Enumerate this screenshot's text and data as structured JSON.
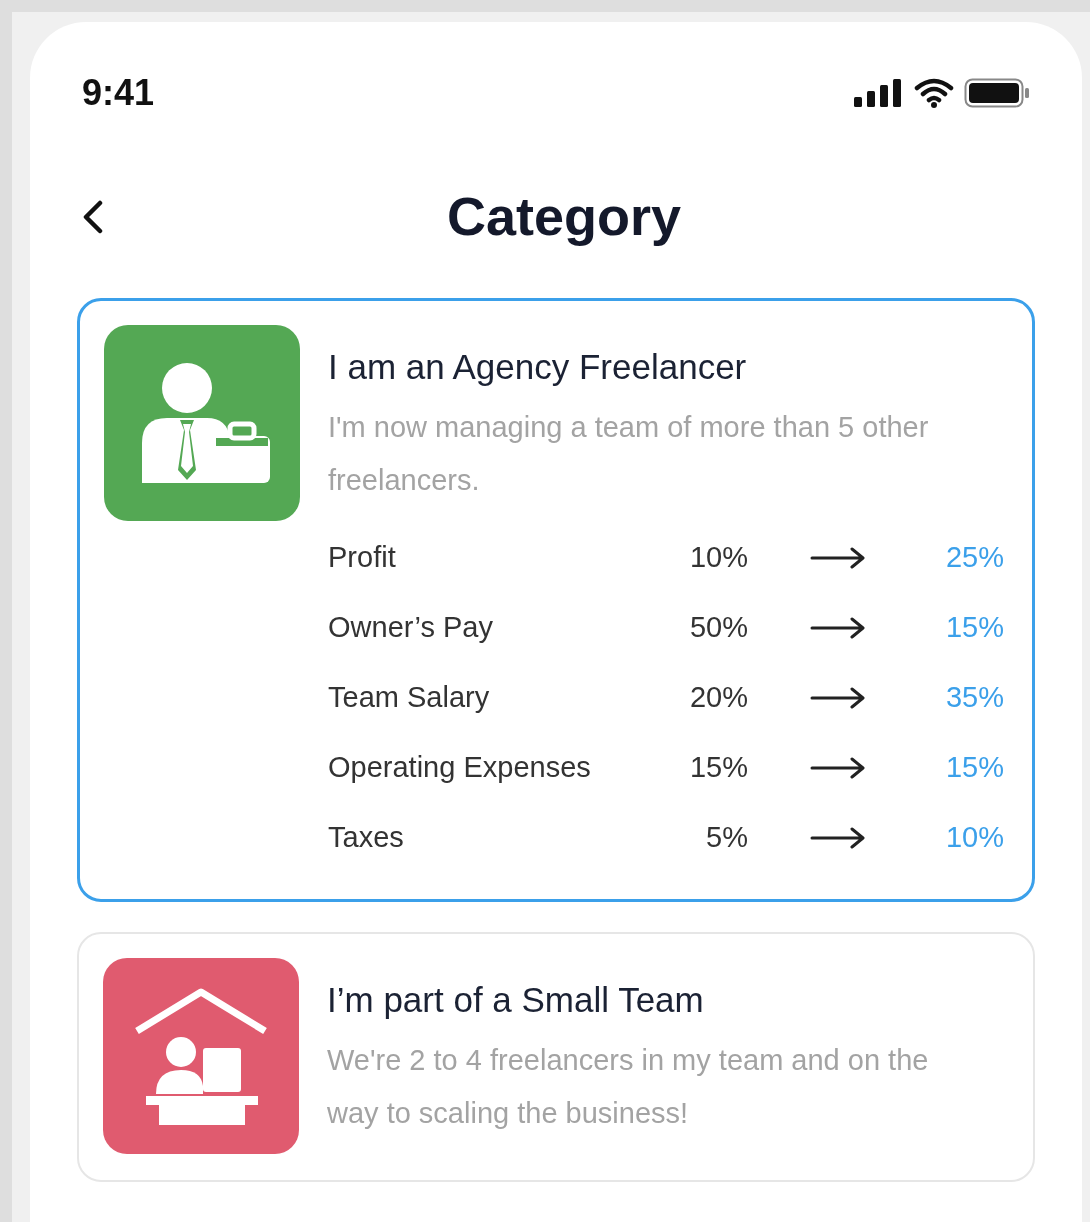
{
  "status_bar": {
    "time": "9:41"
  },
  "header": {
    "title": "Category"
  },
  "categories": [
    {
      "kind": "agency",
      "selected": true,
      "color": "#54a854",
      "title": "I am an Agency Freelancer",
      "description": "I'm now managing a team of more than 5 other freelancers.",
      "rows": [
        {
          "label": "Profit",
          "from": "10%",
          "to": "25%"
        },
        {
          "label": "Owner’s Pay",
          "from": "50%",
          "to": "15%"
        },
        {
          "label": "Team Salary",
          "from": "20%",
          "to": "35%"
        },
        {
          "label": "Operating Expenses",
          "from": "15%",
          "to": "15%"
        },
        {
          "label": "Taxes",
          "from": "5%",
          "to": "10%"
        }
      ]
    },
    {
      "kind": "team",
      "selected": false,
      "color": "#e05b6f",
      "title": "I’m part of a Small Team",
      "description": "We're 2 to 4 freelancers in my team and on the way to scaling the business!"
    }
  ]
}
